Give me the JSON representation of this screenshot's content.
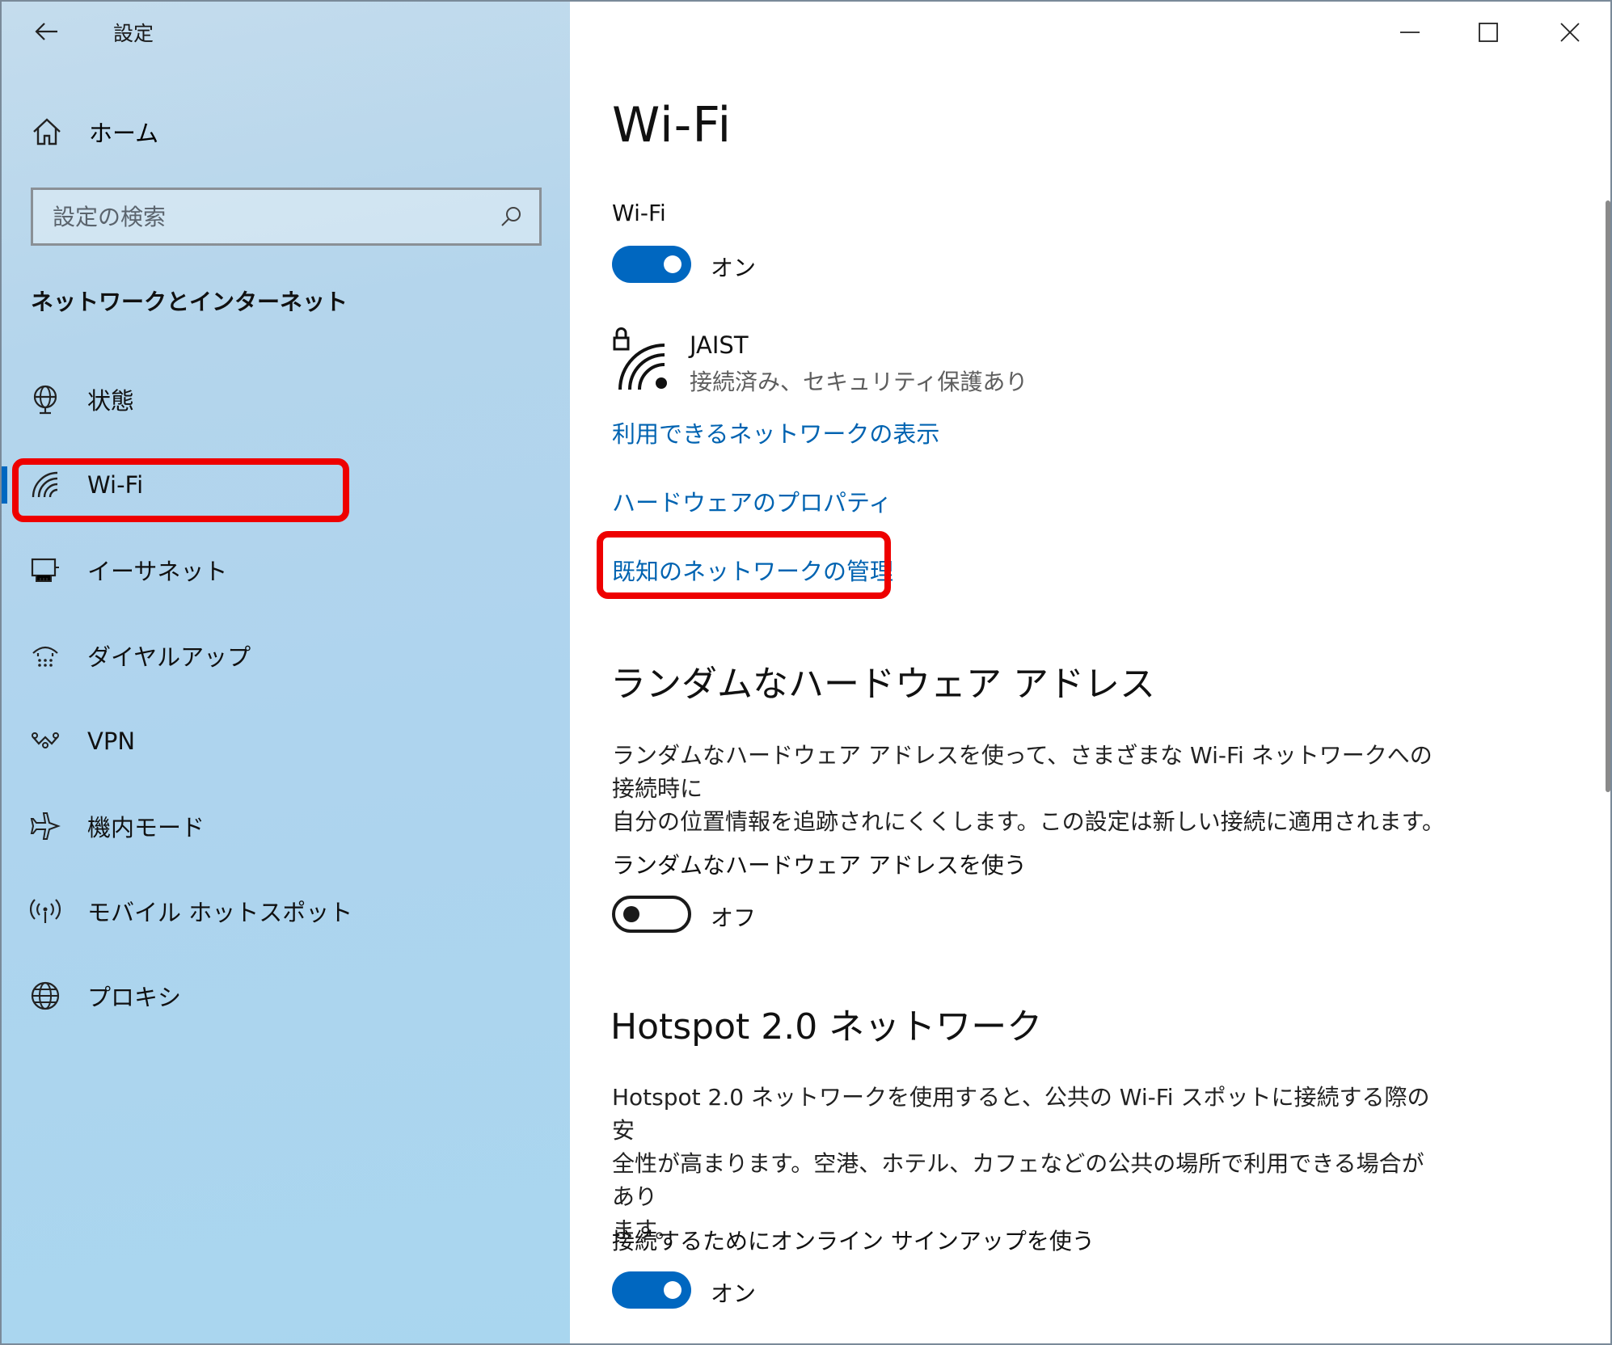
{
  "window": {
    "app_title": "設定",
    "controls": {
      "minimize": "minimize-icon",
      "maximize": "maximize-icon",
      "close": "close-icon"
    }
  },
  "sidebar": {
    "home_label": "ホーム",
    "search": {
      "placeholder": "設定の検索"
    },
    "section_title": "ネットワークとインターネット",
    "items": [
      {
        "label": "状態",
        "icon": "status-globe-icon"
      },
      {
        "label": "Wi-Fi",
        "icon": "wifi-icon",
        "selected": true
      },
      {
        "label": "イーサネット",
        "icon": "ethernet-icon"
      },
      {
        "label": "ダイヤルアップ",
        "icon": "dialup-icon"
      },
      {
        "label": "VPN",
        "icon": "vpn-icon"
      },
      {
        "label": "機内モード",
        "icon": "airplane-icon"
      },
      {
        "label": "モバイル ホットスポット",
        "icon": "hotspot-icon"
      },
      {
        "label": "プロキシ",
        "icon": "globe-icon"
      }
    ]
  },
  "main": {
    "title": "Wi-Fi",
    "wifi_label": "Wi-Fi",
    "wifi_toggle": {
      "state": "オン",
      "on": true
    },
    "network": {
      "name": "JAIST",
      "status": "接続済み、セキュリティ保護あり"
    },
    "links": {
      "available": "利用できるネットワークの表示",
      "hardware": "ハードウェアのプロパティ",
      "known": "既知のネットワークの管理"
    },
    "random_hw": {
      "heading": "ランダムなハードウェア アドレス",
      "desc_line1": "ランダムなハードウェア アドレスを使って、さまざまな Wi-Fi ネットワークへの接続時に",
      "desc_line2": "自分の位置情報を追跡されにくくします。この設定は新しい接続に適用されます。",
      "toggle_label": "ランダムなハードウェア アドレスを使う",
      "toggle": {
        "state": "オフ",
        "on": false
      }
    },
    "hotspot20": {
      "heading": "Hotspot 2.0 ネットワーク",
      "desc_line1": "Hotspot 2.0 ネットワークを使用すると、公共の Wi-Fi スポットに接続する際の安",
      "desc_line2": "全性が高まります。空港、ホテル、カフェなどの公共の場所で利用できる場合があり",
      "desc_line3": "ます。",
      "toggle_label": "接続するためにオンライン サインアップを使う",
      "toggle": {
        "state": "オン",
        "on": true
      }
    }
  },
  "colors": {
    "accent": "#0067c0",
    "link": "#0063b1",
    "highlight": "#ee0000"
  }
}
